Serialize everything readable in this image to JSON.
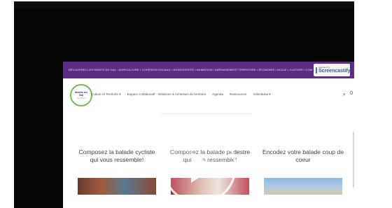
{
  "top_bar": {
    "text": "DÉCOUVREZ LES MONTS DU GAL : AGRICULTURE • COHÉSION SOCIALE • BIODIVERSITÉ • ANIMATION / AMÉNAGEMENT TERRITOIRE • ÉCONOMIE LOCALE • CULTURE / COM"
  },
  "badge": {
    "small": "recorded by",
    "brand": "Screencastify"
  },
  "logo": {
    "line1": "Monts du",
    "line2": "Gal",
    "line3": "Territoire"
  },
  "nav": {
    "items": [
      "Culture et Territoire ▾",
      "Espace Collaboratif - Initiatives & richesses du territoire",
      "Agenda",
      "Ressources",
      "Volontariat ▾"
    ],
    "search_icon": "search-icon",
    "cart_label": "0"
  },
  "cards": [
    {
      "title": "Composez la balade cycliste qui vous ressemble!"
    },
    {
      "title": "Composez la balade pédestre qui vous ressemble!"
    },
    {
      "title": "Encodez votre balade coup de coeur"
    }
  ],
  "overlay": {
    "play_icon": "play-icon"
  },
  "colors": {
    "accent_purple": "#5a2d86",
    "logo_green": "#7ab85c",
    "brand_blue": "#2a5da8"
  }
}
